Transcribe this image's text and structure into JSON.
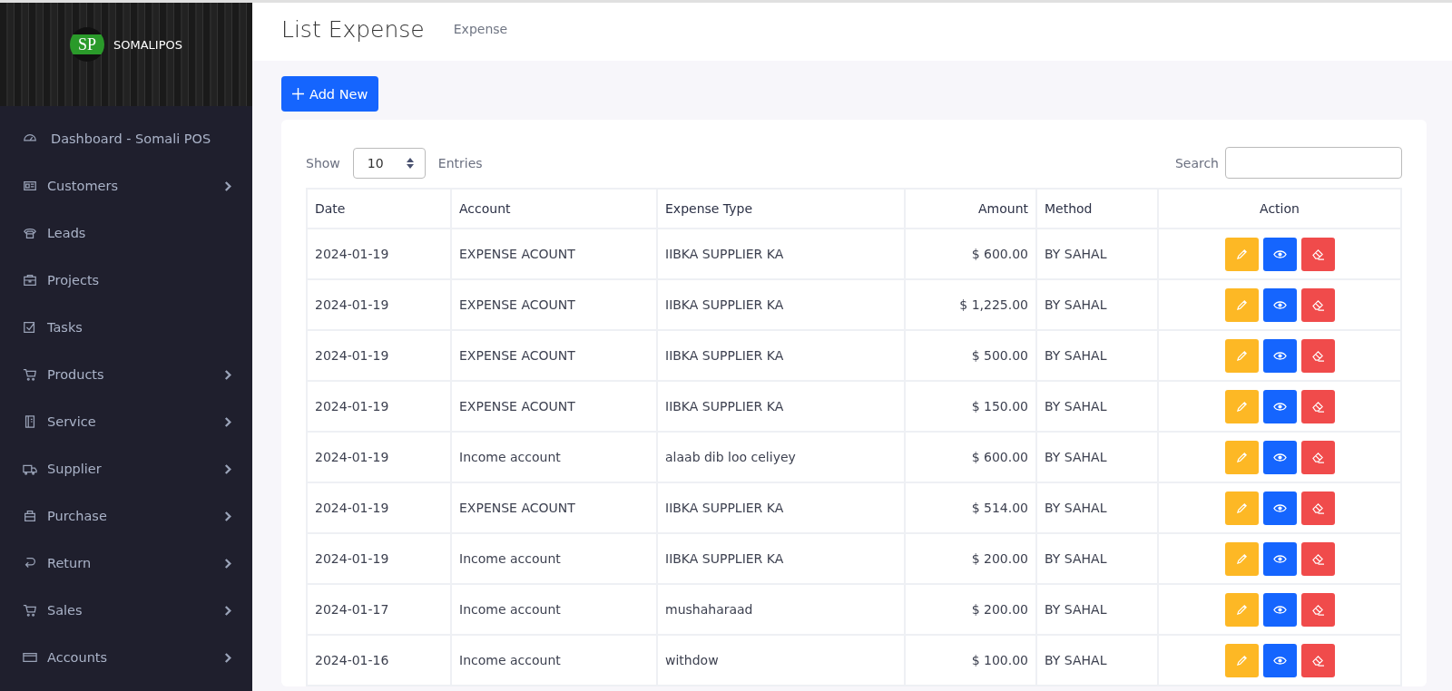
{
  "sidebar": {
    "brand": {
      "logo_text": "SP",
      "name": "SOMALIPOS"
    },
    "items": [
      {
        "label": "Dashboard - Somali POS",
        "expandable": false
      },
      {
        "label": "Customers",
        "expandable": true
      },
      {
        "label": "Leads",
        "expandable": false
      },
      {
        "label": "Projects",
        "expandable": false
      },
      {
        "label": "Tasks",
        "expandable": false
      },
      {
        "label": "Products",
        "expandable": true
      },
      {
        "label": "Service",
        "expandable": true
      },
      {
        "label": "Supplier",
        "expandable": true
      },
      {
        "label": "Purchase",
        "expandable": true
      },
      {
        "label": "Return",
        "expandable": true
      },
      {
        "label": "Sales",
        "expandable": true
      },
      {
        "label": "Accounts",
        "expandable": true
      }
    ]
  },
  "header": {
    "title": "List Expense",
    "breadcrumb": "Expense"
  },
  "add_button": {
    "label": "Add New"
  },
  "table_controls": {
    "show_label": "Show",
    "page_size": "10",
    "entries_label": "Entries",
    "search_label": "Search"
  },
  "table": {
    "columns": [
      "Date",
      "Account",
      "Expense Type",
      "Amount",
      "Method",
      "Action"
    ],
    "rows": [
      [
        "2024-01-19",
        "EXPENSE ACOUNT",
        "IIBKA SUPPLIER KA",
        "$ 600.00",
        "BY SAHAL"
      ],
      [
        "2024-01-19",
        "EXPENSE ACOUNT",
        "IIBKA SUPPLIER KA",
        "$ 1,225.00",
        "BY SAHAL"
      ],
      [
        "2024-01-19",
        "EXPENSE ACOUNT",
        "IIBKA SUPPLIER KA",
        "$ 500.00",
        "BY SAHAL"
      ],
      [
        "2024-01-19",
        "EXPENSE ACOUNT",
        "IIBKA SUPPLIER KA",
        "$ 150.00",
        "BY SAHAL"
      ],
      [
        "2024-01-19",
        "Income account",
        "alaab dib loo celiyey",
        "$ 600.00",
        "BY SAHAL"
      ],
      [
        "2024-01-19",
        "EXPENSE ACOUNT",
        "IIBKA SUPPLIER KA",
        "$ 514.00",
        "BY SAHAL"
      ],
      [
        "2024-01-19",
        "Income account",
        "IIBKA SUPPLIER KA",
        "$ 200.00",
        "BY SAHAL"
      ],
      [
        "2024-01-17",
        "Income account",
        "mushaharaad",
        "$ 200.00",
        "BY SAHAL"
      ],
      [
        "2024-01-16",
        "Income account",
        "withdow",
        "$ 100.00",
        "BY SAHAL"
      ]
    ]
  }
}
